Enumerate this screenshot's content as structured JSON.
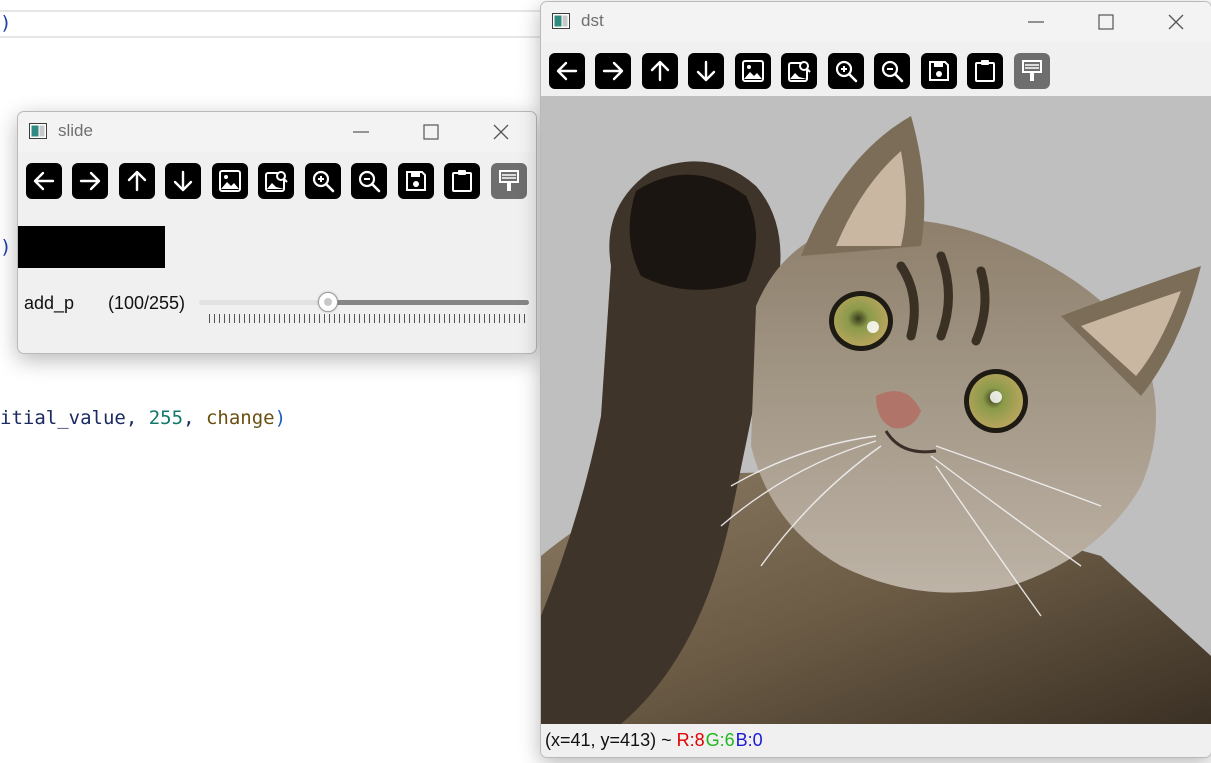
{
  "editor": {
    "line1": ")",
    "line2": ")",
    "line3_var": "itial_value",
    "line3_sep1": ", ",
    "line3_num": "255",
    "line3_sep2": ", ",
    "line3_func": "change",
    "line3_close": ")"
  },
  "slide_window": {
    "title": "slide",
    "trackbar": {
      "name": "add_p",
      "value_text": "(100/255)",
      "value": 100,
      "max": 255
    }
  },
  "dst_window": {
    "title": "dst",
    "status": {
      "coords": "(x=41, y=413) ~ ",
      "r": "R:8",
      "g": "G:6",
      "b": "B:0"
    }
  },
  "toolbar_icons": [
    "arrow-left-icon",
    "arrow-right-icon",
    "arrow-up-icon",
    "arrow-down-icon",
    "image-icon",
    "image-search-icon",
    "zoom-in-icon",
    "zoom-out-icon",
    "save-icon",
    "clipboard-icon",
    "brush-icon"
  ],
  "colors": {
    "status_r": "#e00000",
    "status_g": "#1fb81f",
    "status_b": "#1a1ad6",
    "image_background": "#bfbfbf"
  }
}
